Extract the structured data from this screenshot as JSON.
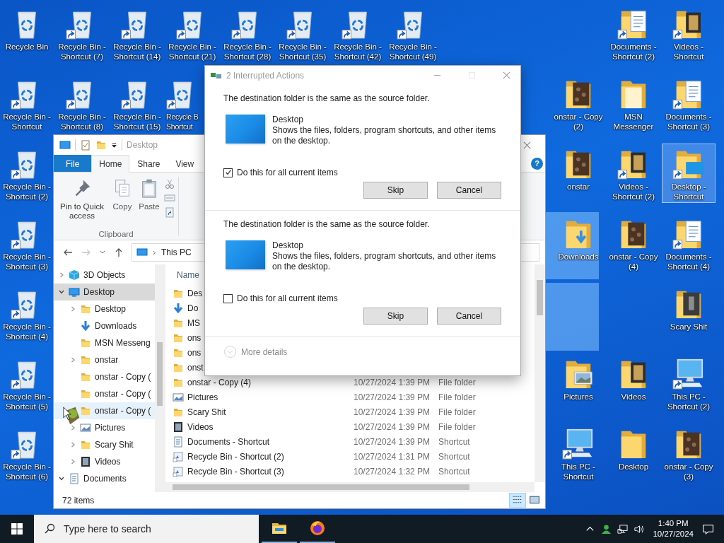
{
  "desktop_icons": [
    {
      "label": "Recycle Bin",
      "kind": "recycle",
      "shortcut": false,
      "selected": false
    },
    {
      "label": "Recycle Bin - Shortcut (7)",
      "kind": "recycle",
      "shortcut": true,
      "selected": false
    },
    {
      "label": "Recycle Bin - Shortcut (14)",
      "kind": "recycle",
      "shortcut": true,
      "selected": false
    },
    {
      "label": "Recycle Bin - Shortcut (21)",
      "kind": "recycle",
      "shortcut": true,
      "selected": false
    },
    {
      "label": "Recycle Bin - Shortcut (28)",
      "kind": "recycle",
      "shortcut": true,
      "selected": false
    },
    {
      "label": "Recycle Bin - Shortcut (35)",
      "kind": "recycle",
      "shortcut": true,
      "selected": false
    },
    {
      "label": "Recycle Bin - Shortcut (42)",
      "kind": "recycle",
      "shortcut": true,
      "selected": false
    },
    {
      "label": "Recycle Bin - Shortcut (49)",
      "kind": "recycle",
      "shortcut": true,
      "selected": false
    },
    {
      "label": "Documents - Shortcut (2)",
      "kind": "documents",
      "shortcut": true,
      "selected": false
    },
    {
      "label": "Videos - Shortcut",
      "kind": "videos",
      "shortcut": true,
      "selected": false
    },
    {
      "label": "Recycle Bin - Shortcut",
      "kind": "recycle",
      "shortcut": true,
      "selected": false
    },
    {
      "label": "Recycle Bin - Shortcut (8)",
      "kind": "recycle",
      "shortcut": true,
      "selected": false
    },
    {
      "label": "Recycle Bin - Shortcut (15)",
      "kind": "recycle",
      "shortcut": true,
      "selected": false
    },
    {
      "label": "Recycle B Shortcut",
      "kind": "recycle",
      "shortcut": true,
      "selected": false
    },
    {
      "label": "onstar - Copy (2)",
      "kind": "photo-folder",
      "shortcut": false,
      "selected": false
    },
    {
      "label": "MSN Messenger",
      "kind": "plain-folder",
      "shortcut": false,
      "selected": false
    },
    {
      "label": "Documents - Shortcut (3)",
      "kind": "documents",
      "shortcut": true,
      "selected": false
    },
    {
      "label": "Recycle Bin - Shortcut (2)",
      "kind": "recycle",
      "shortcut": true,
      "selected": false
    },
    {
      "label": "onstar",
      "kind": "photo-folder",
      "shortcut": false,
      "selected": false
    },
    {
      "label": "Videos - Shortcut (2)",
      "kind": "videos",
      "shortcut": true,
      "selected": false
    },
    {
      "label": "Desktop - Shortcut",
      "kind": "desktop",
      "shortcut": true,
      "selected": true
    },
    {
      "label": "Recycle Bin - Shortcut (3)",
      "kind": "recycle",
      "shortcut": true,
      "selected": false
    },
    {
      "label": "Downloads",
      "kind": "downloads",
      "shortcut": false,
      "selected": false
    },
    {
      "label": "onstar - Copy (4)",
      "kind": "photo-folder",
      "shortcut": false,
      "selected": false
    },
    {
      "label": "Documents - Shortcut (4)",
      "kind": "documents",
      "shortcut": true,
      "selected": false
    },
    {
      "label": "Recycle Bin - Shortcut (4)",
      "kind": "recycle",
      "shortcut": true,
      "selected": false
    },
    {
      "label": "Scary Shit",
      "kind": "dark-folder",
      "shortcut": false,
      "selected": false
    },
    {
      "label": "Recycle Bin - Shortcut (5)",
      "kind": "recycle",
      "shortcut": true,
      "selected": false
    },
    {
      "label": "Pictures",
      "kind": "pictures",
      "shortcut": false,
      "selected": false
    },
    {
      "label": "Videos",
      "kind": "videos",
      "shortcut": false,
      "selected": false
    },
    {
      "label": "This PC - Shortcut (2)",
      "kind": "pc",
      "shortcut": true,
      "selected": false
    },
    {
      "label": "Recycle Bin - Shortcut (6)",
      "kind": "recycle",
      "shortcut": true,
      "selected": false
    },
    {
      "label": "This PC - Shortcut",
      "kind": "pc",
      "shortcut": true,
      "selected": false
    },
    {
      "label": "Desktop",
      "kind": "folder",
      "shortcut": false,
      "selected": false
    },
    {
      "label": "onstar - Copy (3)",
      "kind": "photo-folder",
      "shortcut": false,
      "selected": false
    }
  ],
  "explorer": {
    "title": "Desktop",
    "ribbon_tabs": [
      {
        "label": "File",
        "kind": "file",
        "selected": false
      },
      {
        "label": "Home",
        "kind": "tab",
        "selected": true
      },
      {
        "label": "Share",
        "kind": "tab",
        "selected": false
      },
      {
        "label": "View",
        "kind": "tab",
        "selected": false
      }
    ],
    "help": "?",
    "commands": [
      {
        "label": "Pin to Quick access",
        "kind": "pin"
      },
      {
        "label": "Copy",
        "kind": "copy"
      },
      {
        "label": "Paste",
        "kind": "paste"
      }
    ],
    "group_label": "Clipboard",
    "address": [
      "This PC"
    ],
    "tree": [
      {
        "label": "3D Objects",
        "kind": "cube",
        "expandable": true,
        "expanded": false,
        "selected": false,
        "hovered": false
      },
      {
        "label": "Desktop",
        "kind": "pc",
        "expandable": true,
        "expanded": true,
        "selected": true,
        "hovered": false,
        "children": [
          {
            "label": "Desktop",
            "kind": "folder",
            "expandable": true,
            "expanded": false,
            "selected": false,
            "hovered": false
          },
          {
            "label": "Downloads",
            "kind": "downloads",
            "expandable": false,
            "selected": false,
            "hovered": false
          },
          {
            "label": "MSN Messeng",
            "kind": "folder",
            "expandable": false,
            "selected": false,
            "hovered": false
          },
          {
            "label": "onstar",
            "kind": "folder",
            "expandable": true,
            "expanded": false,
            "selected": false,
            "hovered": false
          },
          {
            "label": "onstar - Copy (",
            "kind": "folder",
            "expandable": false,
            "selected": false,
            "hovered": false
          },
          {
            "label": "onstar - Copy (",
            "kind": "folder",
            "expandable": false,
            "selected": false,
            "hovered": false
          },
          {
            "label": "onstar - Copy (",
            "kind": "folder",
            "expandable": false,
            "selected": false,
            "hovered": true
          },
          {
            "label": "Pictures",
            "kind": "pictures",
            "expandable": true,
            "expanded": false,
            "selected": false,
            "hovered": false
          },
          {
            "label": "Scary Shit",
            "kind": "folder",
            "expandable": true,
            "expanded": false,
            "selected": false,
            "hovered": false
          },
          {
            "label": "Videos",
            "kind": "videos",
            "expandable": true,
            "expanded": false,
            "selected": false,
            "hovered": false
          }
        ]
      },
      {
        "label": "Documents",
        "kind": "documents",
        "expandable": true,
        "expanded": true,
        "selected": false,
        "hovered": false
      }
    ],
    "columns": [
      "Name"
    ],
    "files": [
      {
        "name": "Des",
        "kind": "folder"
      },
      {
        "name": "Do",
        "kind": "downloads"
      },
      {
        "name": "MS",
        "kind": "folder"
      },
      {
        "name": "ons",
        "kind": "folder"
      },
      {
        "name": "ons",
        "kind": "folder"
      },
      {
        "name": "onst",
        "kind": "folder"
      },
      {
        "name": "onstar - Copy (4)",
        "date": "10/27/2024 1:39 PM",
        "type": "File folder",
        "kind": "folder"
      },
      {
        "name": "Pictures",
        "date": "10/27/2024 1:39 PM",
        "type": "File folder",
        "kind": "pictures"
      },
      {
        "name": "Scary Shit",
        "date": "10/27/2024 1:39 PM",
        "type": "File folder",
        "kind": "folder"
      },
      {
        "name": "Videos",
        "date": "10/27/2024 1:39 PM",
        "type": "File folder",
        "kind": "videos"
      },
      {
        "name": "Documents - Shortcut",
        "date": "10/27/2024 1:39 PM",
        "type": "Shortcut",
        "kind": "documents"
      },
      {
        "name": "Recycle Bin - Shortcut (2)",
        "date": "10/27/2024 1:31 PM",
        "type": "Shortcut",
        "kind": "recycle"
      },
      {
        "name": "Recycle Bin - Shortcut (3)",
        "date": "10/27/2024 1:32 PM",
        "type": "Shortcut",
        "kind": "recycle"
      }
    ],
    "status": "72 items",
    "views": [
      {
        "kind": "details",
        "selected": true
      },
      {
        "kind": "large",
        "selected": false
      }
    ]
  },
  "dialog": {
    "title": "2 Interrupted Actions",
    "conflicts": [
      {
        "message": "The destination folder is the same as the source folder.",
        "item": "Desktop",
        "description": "Shows the files, folders, program shortcuts, and other items on the desktop.",
        "apply_all": "Do this for all current items",
        "checked": true,
        "buttons": [
          "Skip",
          "Cancel"
        ]
      },
      {
        "message": "The destination folder is the same as the source folder.",
        "item": "Desktop",
        "description": "Shows the files, folders, program shortcuts, and other items on the desktop.",
        "apply_all": "Do this for all current items",
        "checked": false,
        "buttons": [
          "Skip",
          "Cancel"
        ]
      }
    ],
    "more_details": "More details"
  },
  "taskbar": {
    "search_placeholder": "Type here to search",
    "apps": [
      {
        "kind": "explorer",
        "running": true
      },
      {
        "kind": "firefox",
        "running": true
      }
    ],
    "time": "1:40 PM",
    "date": "10/27/2024"
  }
}
